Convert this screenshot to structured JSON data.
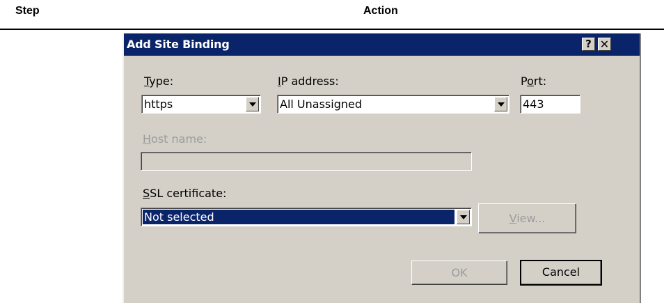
{
  "table_header": {
    "step": "Step",
    "action": "Action"
  },
  "dialog": {
    "title": "Add Site Binding",
    "help_glyph": "?",
    "close_glyph": "✕",
    "type": {
      "label_accel": "T",
      "label_rest": "ype:",
      "value": "https"
    },
    "ip": {
      "label_accel": "I",
      "label_rest": "P address:",
      "value": "All Unassigned"
    },
    "port": {
      "label_pre": "P",
      "label_accel": "o",
      "label_rest": "rt:",
      "value": "443"
    },
    "host": {
      "label_accel": "H",
      "label_rest": "ost name:",
      "value": ""
    },
    "ssl": {
      "label_accel": "S",
      "label_rest": "SL certificate:",
      "value": "Not selected"
    },
    "view": {
      "label_accel": "V",
      "label_rest": "iew..."
    },
    "ok_label": "OK",
    "cancel_label": "Cancel"
  }
}
